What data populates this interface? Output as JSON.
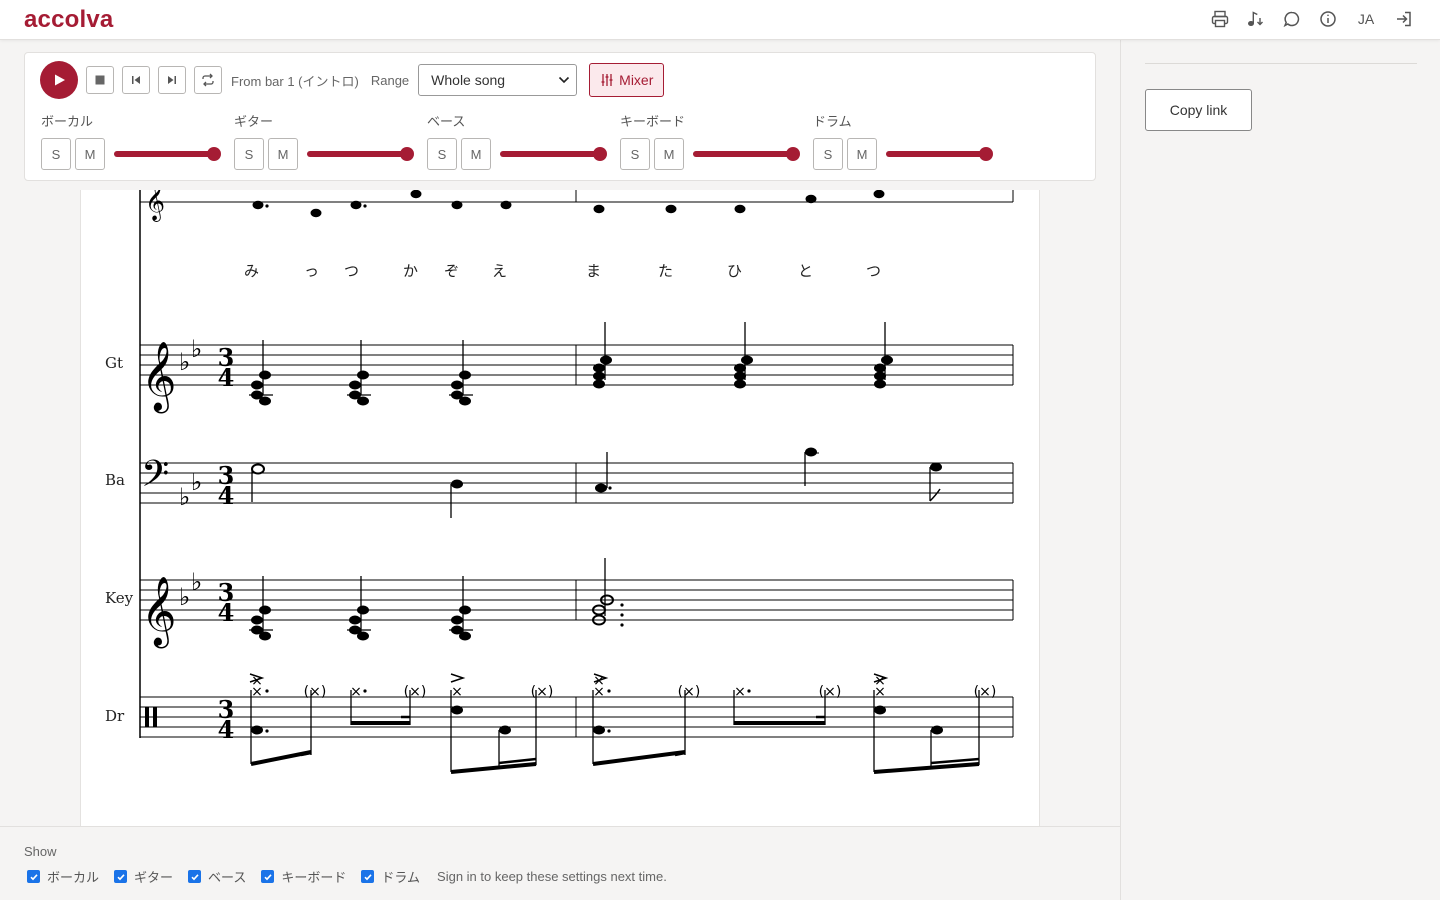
{
  "app": {
    "logo": "accolva",
    "brand_color": "#a51c34"
  },
  "header": {
    "icons": [
      "print-icon",
      "music-notes-icon",
      "comment-icon",
      "info-icon",
      "sign-in-icon"
    ],
    "language": "JA"
  },
  "player": {
    "from_label": "From bar 1 (イントロ)",
    "range_label": "Range",
    "range_value": "Whole song",
    "mixer_label": "Mixer",
    "tracks": [
      {
        "name": "ボーカル",
        "solo": "S",
        "mute": "M",
        "volume": 1.0
      },
      {
        "name": "ギター",
        "solo": "S",
        "mute": "M",
        "volume": 1.0
      },
      {
        "name": "ベース",
        "solo": "S",
        "mute": "M",
        "volume": 1.0
      },
      {
        "name": "キーボード",
        "solo": "S",
        "mute": "M",
        "volume": 1.0
      },
      {
        "name": "ドラム",
        "solo": "S",
        "mute": "M",
        "volume": 1.0
      }
    ]
  },
  "sheet": {
    "lyrics": [
      "み",
      "っ",
      "つ",
      "か",
      "ぞ",
      "え",
      "ま",
      "た",
      "ひ",
      "と",
      "つ"
    ],
    "staff_labels": [
      "Gt",
      "Ba",
      "Key",
      "Dr"
    ],
    "time_signature": {
      "top": "3",
      "bottom": "4"
    },
    "drum_ghost_mark": "(×)"
  },
  "sidebar": {
    "copy_link_label": "Copy link"
  },
  "show": {
    "title": "Show",
    "items": [
      "ボーカル",
      "ギター",
      "ベース",
      "キーボード",
      "ドラム"
    ],
    "note": "Sign in to keep these settings next time."
  }
}
